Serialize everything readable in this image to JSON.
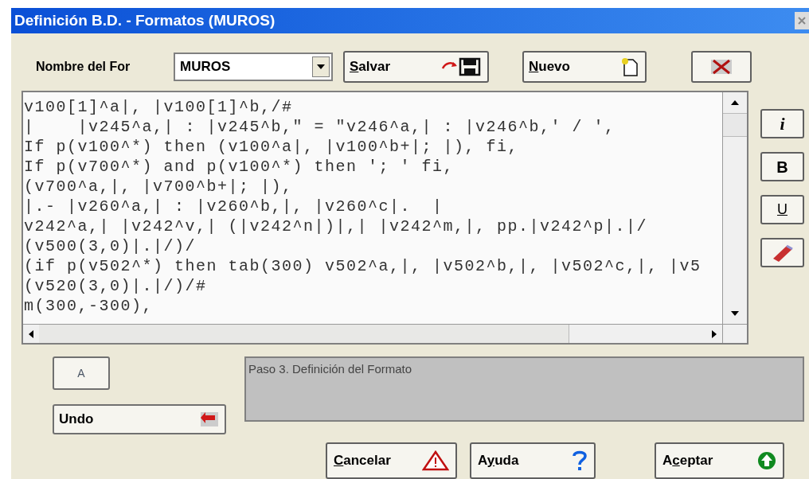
{
  "window": {
    "title": "Definición B.D. - Formatos (MUROS)"
  },
  "format_name": {
    "label": "Nombre del For",
    "value": "MUROS"
  },
  "top_buttons": [
    {
      "kind": "save",
      "key": "S",
      "rest": "alvar"
    },
    {
      "kind": "new",
      "key": "N",
      "rest": "uevo"
    },
    {
      "kind": "delete"
    }
  ],
  "editor_lines": [
    "v100[1]^a|, |v100[1]^b,/#",
    "|    |v245^a,| : |v245^b,\" = \"v246^a,| : |v246^b,' / ',",
    "If p(v100^*) then (v100^a|, |v100^b+|; |), fi,",
    "If p(v700^*) and p(v100^*) then '; ' fi,",
    "(v700^a,|, |v700^b+|; |),",
    "|.- |v260^a,| : |v260^b,|, |v260^c|.  |",
    "v242^a,| |v242^v,| (|v242^n|)|,| |v242^m,|, pp.|v242^p|.|/",
    "(v500(3,0)|.|/)/",
    "(if p(v502^*) then tab(300) v502^a,|, |v502^b,|, |v502^c,|, |v5",
    "(v520(3,0)|.|/)/#",
    "m(300,-300),"
  ],
  "side_buttons": [
    {
      "kind": "italic",
      "text": "i"
    },
    {
      "kind": "bold",
      "text": "B"
    },
    {
      "kind": "underline",
      "text": "U"
    },
    {
      "kind": "eraser"
    }
  ],
  "font_button": {
    "text": "A"
  },
  "undo_button": {
    "label": "Undo"
  },
  "status": "Paso 3. Definición del Formato",
  "bottom_buttons": [
    {
      "kind": "cancel",
      "key": "C",
      "rest": "ancelar"
    },
    {
      "kind": "help",
      "lead": "A",
      "key": "y",
      "rest": "uda"
    },
    {
      "kind": "accept",
      "lead": "A",
      "key": "c",
      "rest": "eptar"
    }
  ]
}
